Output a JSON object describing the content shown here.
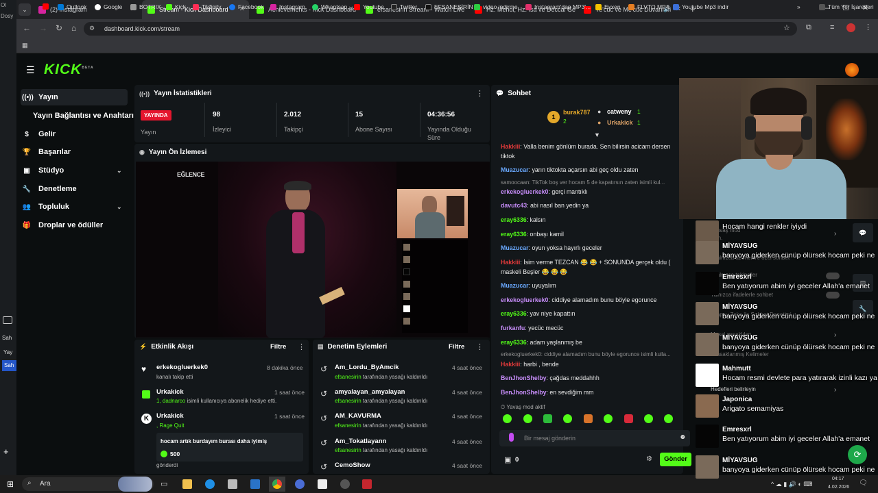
{
  "browser": {
    "tabs": [
      {
        "label": "(2) Instagram",
        "color": "#d6249f"
      },
      {
        "label": "Stream - Kick Dashboard",
        "color": "#53fc18"
      },
      {
        "label": "Achievements - Kick Dashboard",
        "color": "#53fc18"
      },
      {
        "label": "efsanesirin Stream - Watch Live",
        "color": "#53fc18"
      },
      {
        "label": "Hz. Mehdi, Hz. İsa ve Deccal Ge",
        "color": "#ff0000"
      },
      {
        "label": "Ye'cüc ve Me'cüc Duvarının",
        "color": "#ff0000"
      }
    ],
    "url": "dashboard.kick.com/stream",
    "bookmarks": [
      "Outlook",
      "Google",
      "BOTRIX",
      "Kick",
      "Tikfinity",
      "Facebook",
      "Instagram",
      "Whaptsap",
      "Youtube",
      "Twitter",
      "EFSANESİRİN",
      "video indirme",
      "Instagram'dan MP3'...",
      "Exxen",
      "FLVTO MP4",
      "Youtube Mp3 indir"
    ],
    "bookmarks_all": "Tüm Yer İşaretleri",
    "left_edge": [
      "Ol",
      "Dosy",
      "Sah",
      "Yay",
      "Sah"
    ]
  },
  "kick": {
    "logo": "KICK",
    "logo_badge": "BETA",
    "sidebar": [
      {
        "label": "Yayın",
        "icon": "stream-icon"
      },
      {
        "label": "Yayın Bağlantısı ve Anahtarı",
        "icon": ""
      },
      {
        "label": "Gelir",
        "icon": "dollar-icon"
      },
      {
        "label": "Başarılar",
        "icon": "trophy-icon"
      },
      {
        "label": "Stüdyo",
        "icon": "studio-icon",
        "chevron": true
      },
      {
        "label": "Denetleme",
        "icon": "wrench-icon"
      },
      {
        "label": "Topluluk",
        "icon": "people-icon",
        "chevron": true
      },
      {
        "label": "Droplar ve ödüller",
        "icon": "gift-icon"
      }
    ],
    "stats": {
      "title": "Yayın İstatistikleri",
      "live_badge": "YAYINDA",
      "live_label": "Yayın",
      "items": [
        {
          "value": "98",
          "label": "İzleyici"
        },
        {
          "value": "2.012",
          "label": "Takipçi"
        },
        {
          "value": "15",
          "label": "Abone Sayısı"
        },
        {
          "value": "04:36:56",
          "label": "Yayında Olduğu Süre"
        }
      ]
    },
    "preview": {
      "title": "Yayın Ön İzlemesi",
      "overlay_text": "EĞLENCE"
    },
    "events": {
      "title": "Etkinlik Akışı",
      "filter": "Filtre",
      "items": [
        {
          "name": "erkekogluerkek0",
          "desc": "kanalı takip etti",
          "time": "8 dakika önce",
          "icon": "heart-icon"
        },
        {
          "name": "Urkakick",
          "desc_highlight": "1, dadnarco",
          "desc": "isimli kullanıcıya abonelik hediye etti.",
          "time": "1 saat önce",
          "icon": "gift-icon"
        },
        {
          "name": "Urkakick",
          "desc_highlight": ", Rage Quit",
          "time": "1 saat önce",
          "icon": "kick-icon",
          "message": "hocam artık burdayım burası daha iyimiş",
          "amount": "500",
          "sent": "gönderdi"
        }
      ]
    },
    "moderation": {
      "title": "Denetim Eylemleri",
      "filter": "Filtre",
      "items": [
        {
          "name": "Am_Lordu_ByAmcik",
          "by": "efsanesirin",
          "action": "tarafından yasağı kaldırıldı",
          "time": "4 saat önce"
        },
        {
          "name": "amyalayan_amyalayan",
          "by": "efsanesirin",
          "action": "tarafından yasağı kaldırıldı",
          "time": "4 saat önce"
        },
        {
          "name": "AM_KAVURMA",
          "by": "efsanesirin",
          "action": "tarafından yasağı kaldırıldı",
          "time": "4 saat önce"
        },
        {
          "name": "Am_Tokatlayann",
          "by": "efsanesirin",
          "action": "tarafından yasağı kaldırıldı",
          "time": "4 saat önce"
        },
        {
          "name": "CemoShow",
          "by": "",
          "action": "",
          "time": "4 saat önce"
        }
      ]
    },
    "chat": {
      "title": "Sohbet",
      "leaders": [
        {
          "name": "burak787",
          "count": "2"
        },
        {
          "name": "catweny",
          "count": "1"
        },
        {
          "name": "Urkakick",
          "count": "1"
        }
      ],
      "messages": [
        {
          "user": "Hakkiii",
          "color": "u-red",
          "text": ": Valla benim gönlüm burada. Sen bilirsin acicam dersen"
        },
        {
          "user": "",
          "color": "",
          "text": "tiktok"
        },
        {
          "user": "Muazucar",
          "color": "u-blue",
          "text": ": yarın tiktokta açarsın abi geç oldu zaten"
        },
        {
          "reply": "samoocaan: TikTok boş ver hocam 5 de kapatırsın zaten isimli kul..."
        },
        {
          "user": "erkekogluerkek0",
          "color": "u-purple",
          "text": ": gerçi mantıklı"
        },
        {
          "user": "davutc43",
          "color": "u-purple",
          "text": ": abi nasıl ban yedin ya"
        },
        {
          "user": "eray6336",
          "color": "u-green",
          "text": ": kalsın"
        },
        {
          "user": "eray6336",
          "color": "u-green",
          "text": ": onbaşı kamil"
        },
        {
          "user": "Muazucar",
          "color": "u-blue",
          "text": ": oyun yoksa hayırlı geceler"
        },
        {
          "user": "Hakkiii",
          "color": "u-red",
          "text": ": İsim verme TEZCAN 😂 😂 + SONUNDA gerçek oldu ("
        },
        {
          "user": "",
          "color": "",
          "text": "maskeli Beşler 😂 😂 😂"
        },
        {
          "user": "Muazucar",
          "color": "u-blue",
          "text": ": uyuyalım"
        },
        {
          "user": "erkekogluerkek0",
          "color": "u-purple",
          "text": ": ciddiye alamadım bunu böyle egorunce"
        },
        {
          "user": "eray6336",
          "color": "u-green",
          "text": ": yav niye kapattın"
        },
        {
          "user": "furkanfu",
          "color": "u-purple",
          "text": ": yecüc mecüc"
        },
        {
          "user": "eray6336",
          "color": "u-green",
          "text": ": adam yaşlanmış be"
        },
        {
          "reply": "erkekogluerkek0: ciddiye alamadım bunu böyle egorunce isimli kulla..."
        },
        {
          "user": "Hakkiii",
          "color": "u-red",
          "text": ": harbi , bende"
        },
        {
          "user": "BenJhonShelby",
          "color": "u-purple",
          "text": ": çağdas meddahhh"
        },
        {
          "user": "BenJhonShelby",
          "color": "u-purple",
          "text": ": en sevdiğim mm"
        }
      ],
      "slow_mode": "Yavaş mod aktif",
      "input_placeholder": "Bir mesaj gönderin",
      "points": "0",
      "send": "Gönder"
    }
  },
  "overlay_chat": [
    {
      "name": "",
      "msg": "Hocam hangi renkler iyiydi",
      "avatar": "#6b5a4a"
    },
    {
      "name": "MİYAVSUG",
      "msg": "banyoya giderken cünüp ölürsek hocam peki ne",
      "avatar": "#7a6a5a"
    },
    {
      "name": "Emresxrl",
      "msg": "Ben yatıyorum abim iyi geceler Allah'a emanet",
      "avatar": "#050505"
    },
    {
      "name": "MİYAVSUG",
      "msg": "banyoya giderken cünüp ölürsek hocam peki ne",
      "avatar": "#7a6a5a"
    },
    {
      "name": "MİYAVSUG",
      "msg": "banyoya giderken cünüp ölürsek hocam peki ne",
      "avatar": "#7a6a5a"
    },
    {
      "name": "Mahmutt",
      "msg": "Hocam resmi devlete para yatırarak izinli kazı ya",
      "avatar": "#ffffff"
    },
    {
      "name": "Japonica",
      "msg": "Arigato semamiyas",
      "avatar": "#8a6a50"
    },
    {
      "name": "Emresxrl",
      "msg": "Ben yatıyorum abim iyi geceler Allah'a emanet",
      "avatar": "#050505"
    },
    {
      "name": "MİYAVSUG",
      "msg": "banyoya giderken cünüp ölürsek hocam peki ne",
      "avatar": "#7a6a5a"
    }
  ],
  "ghost_text": [
    "Yavaş mod",
    "5 sn.",
    "Yalnızca takipçiler",
    "Yalnızca abonelere özel sohbet",
    "Yalnızca ifadelerle sohbet",
    "Yapay Zeka ile Sohbet Denetimi",
    "Mesaj yasaklıları",
    "Yasaklanmış Kelimeler",
    "Hedefleri belirleyin"
  ],
  "taskbar": {
    "search": "Ara",
    "time": "04:17",
    "date": "4.02.2026"
  }
}
